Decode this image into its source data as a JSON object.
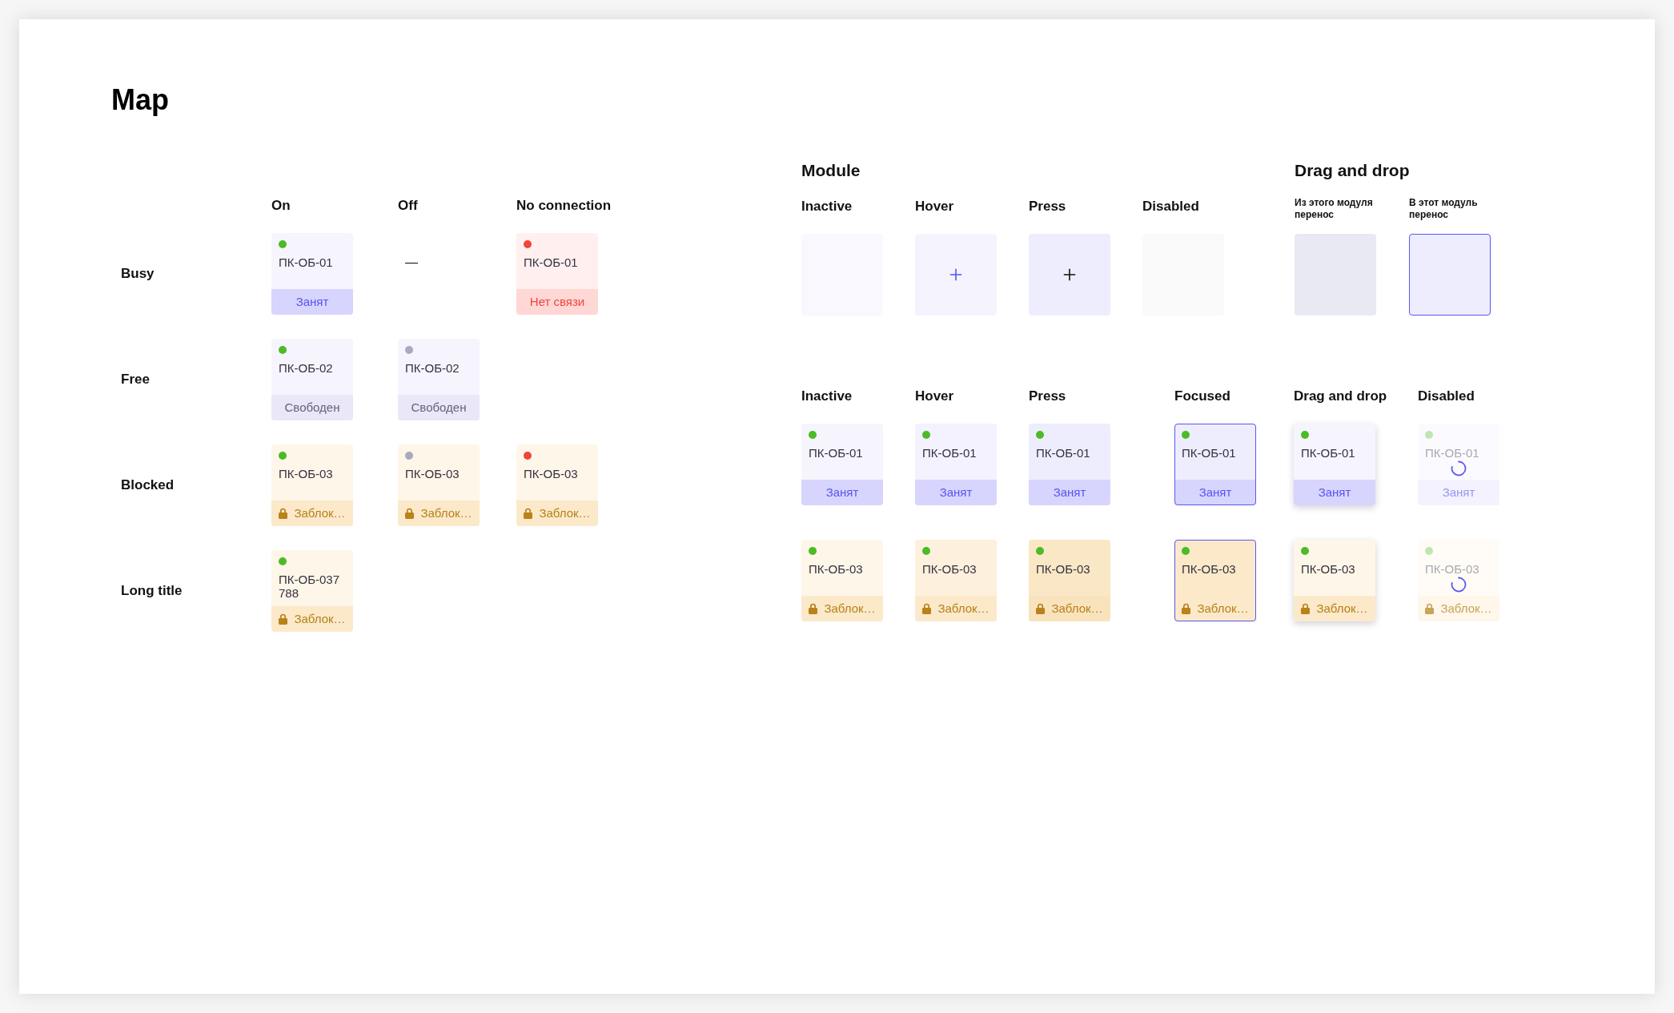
{
  "title": "Map",
  "availability_table": {
    "columns": [
      "On",
      "Off",
      "No connection"
    ],
    "rows": [
      {
        "label": "Busy",
        "cells": [
          {
            "kind": "busy",
            "color": "#4cbb27",
            "title": "ПК-ОБ-01",
            "status": "Занят"
          },
          {
            "kind": "dash",
            "text": "—"
          },
          {
            "kind": "offline",
            "color": "#f0453a",
            "title": "ПК-ОБ-01",
            "status": "Нет связи"
          }
        ]
      },
      {
        "label": "Free",
        "cells": [
          {
            "kind": "free",
            "color": "#4cbb27",
            "title": "ПК-ОБ-02",
            "status": "Свободен"
          },
          {
            "kind": "free",
            "color": "#aaa9bd",
            "title": "ПК-ОБ-02",
            "status": "Свободен"
          }
        ]
      },
      {
        "label": "Blocked",
        "cells": [
          {
            "kind": "blocked",
            "color": "#4cbb27",
            "title": "ПК-ОБ-03",
            "status": "Заблок…"
          },
          {
            "kind": "blocked",
            "color": "#aaa9bd",
            "title": "ПК-ОБ-03",
            "status": "Заблок…"
          },
          {
            "kind": "blocked",
            "color": "#f0453a",
            "title": "ПК-ОБ-03",
            "status": "Заблок…"
          }
        ]
      },
      {
        "label": "Long title",
        "cells": [
          {
            "kind": "blocked",
            "color": "#4cbb27",
            "title": "ПК-ОБ-037 788",
            "status": "Заблок…"
          }
        ]
      }
    ]
  },
  "module": {
    "title": "Module",
    "columns": [
      {
        "heading": "Inactive",
        "kind": "inactive"
      },
      {
        "heading": "Hover",
        "kind": "hover"
      },
      {
        "heading": "Press",
        "kind": "press"
      },
      {
        "heading": "Disabled",
        "kind": "disabled"
      }
    ]
  },
  "drag_and_drop": {
    "title": "Drag and drop",
    "columns": [
      {
        "heading": "Из этого модуля перенос",
        "kind": "source"
      },
      {
        "heading": "В этот модуль перенос",
        "kind": "target"
      }
    ]
  },
  "card_states": {
    "columns": [
      {
        "heading": "Inactive",
        "kind": "inactive"
      },
      {
        "heading": "Hover",
        "kind": "hover"
      },
      {
        "heading": "Press",
        "kind": "press"
      },
      {
        "heading": "Focused",
        "kind": "focused"
      },
      {
        "heading": "Drag and drop",
        "kind": "dragging"
      },
      {
        "heading": "Disabled",
        "kind": "disabled"
      }
    ],
    "rows": [
      {
        "cards": [
          {
            "kind": "busy",
            "color": "#4cbb27",
            "title": "ПК-ОБ-01",
            "status": "Занят",
            "loading": false
          },
          {
            "kind": "busy",
            "color": "#4cbb27",
            "title": "ПК-ОБ-01",
            "status": "Занят",
            "loading": false
          },
          {
            "kind": "busy",
            "color": "#4cbb27",
            "title": "ПК-ОБ-01",
            "status": "Занят",
            "loading": false
          },
          {
            "kind": "busy",
            "color": "#4cbb27",
            "title": "ПК-ОБ-01",
            "status": "Занят",
            "loading": false
          },
          {
            "kind": "busy",
            "color": "#4cbb27",
            "title": "ПК-ОБ-01",
            "status": "Занят",
            "loading": false
          },
          {
            "kind": "busy",
            "color": "#bfe6b1",
            "title": "ПК-ОБ-01",
            "status": "Занят",
            "loading": true
          }
        ]
      },
      {
        "cards": [
          {
            "kind": "blocked",
            "color": "#4cbb27",
            "title": "ПК-ОБ-03",
            "status": "Заблок…",
            "loading": false
          },
          {
            "kind": "blocked",
            "color": "#4cbb27",
            "title": "ПК-ОБ-03",
            "status": "Заблок…",
            "loading": false
          },
          {
            "kind": "blocked",
            "color": "#4cbb27",
            "title": "ПК-ОБ-03",
            "status": "Заблок…",
            "loading": false
          },
          {
            "kind": "blocked",
            "color": "#4cbb27",
            "title": "ПК-ОБ-03",
            "status": "Заблок…",
            "loading": false
          },
          {
            "kind": "blocked",
            "color": "#4cbb27",
            "title": "ПК-ОБ-03",
            "status": "Заблок…",
            "loading": false
          },
          {
            "kind": "blocked",
            "color": "#bfe6b1",
            "title": "ПК-ОБ-03",
            "status": "Заблок…",
            "loading": true
          }
        ]
      }
    ]
  }
}
